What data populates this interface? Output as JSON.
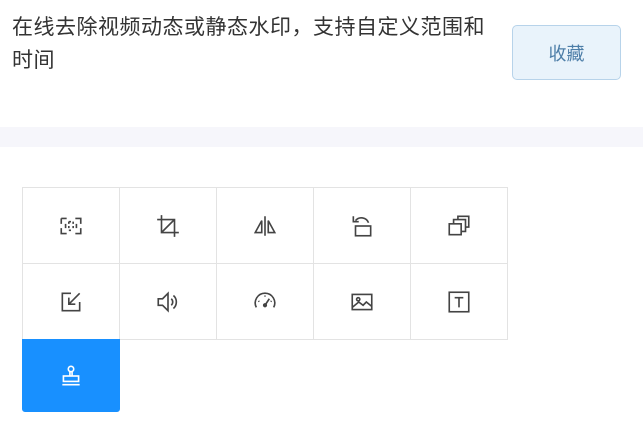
{
  "header": {
    "description": "在线去除视频动态或静态水印，支持自定义范围和时间",
    "favorite_label": "收藏"
  },
  "tools": [
    {
      "icon": "crop-area-icon"
    },
    {
      "icon": "crop-icon"
    },
    {
      "icon": "flip-icon"
    },
    {
      "icon": "rotate-icon"
    },
    {
      "icon": "resize-icon"
    },
    {
      "icon": "export-icon"
    },
    {
      "icon": "volume-icon"
    },
    {
      "icon": "speed-icon"
    },
    {
      "icon": "image-icon"
    },
    {
      "icon": "text-icon"
    },
    {
      "icon": "stamp-icon",
      "active": true
    }
  ],
  "colors": {
    "accent": "#1890ff",
    "favorite_bg": "#e9f3fb",
    "favorite_text": "#4d7ea8",
    "icon": "#444444"
  }
}
